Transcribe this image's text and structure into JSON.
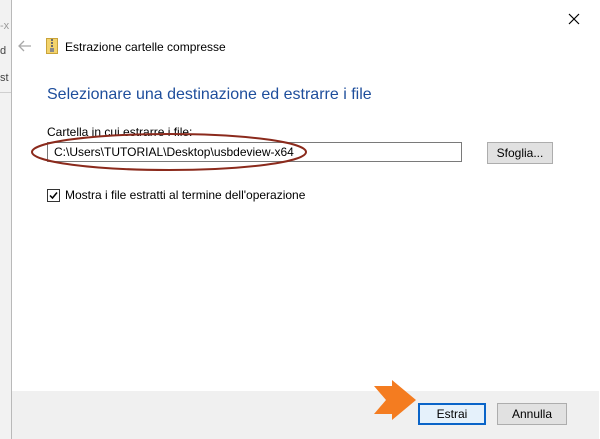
{
  "background": {
    "fragments": [
      "-x",
      "d",
      "st"
    ]
  },
  "dialog": {
    "title": "Estrazione cartelle compresse",
    "heading": "Selezionare una destinazione ed estrarre i file",
    "destination_label": "Cartella in cui estrarre i file:",
    "destination_value": "C:\\Users\\TUTORIAL\\Desktop\\usbdeview-x64",
    "browse_label": "Sfoglia...",
    "show_files_label": "Mostra i file estratti al termine dell'operazione",
    "show_files_checked": true,
    "extract_label": "Estrai",
    "cancel_label": "Annulla"
  },
  "colors": {
    "heading": "#1e4e9c",
    "annotation": "#8b2a1c",
    "arrow": "#f47c20",
    "default_button_border": "#0a64c8"
  },
  "icons": {
    "close": "close-icon",
    "back": "back-arrow-icon",
    "zip_folder": "zip-folder-icon",
    "checkmark": "checkmark-icon",
    "pointer_arrow": "orange-arrow-icon"
  }
}
